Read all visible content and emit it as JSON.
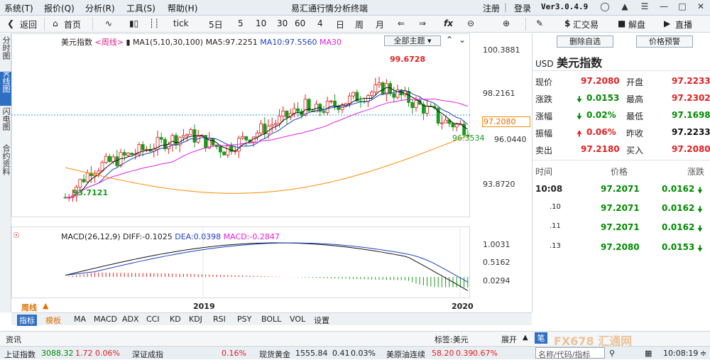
{
  "menubar": {
    "menus": [
      "系统(T)",
      "报价(Q)",
      "分析(R)",
      "工具(S)",
      "帮助(H)"
    ],
    "title": "易汇通行情分析终端",
    "register": "注册",
    "login": "登录",
    "version": "Ver3.0.4.9"
  },
  "toolbar": {
    "back": "返回",
    "home": "首页",
    "tick": "tick",
    "periods": [
      "5日",
      "5",
      "10",
      "30",
      "60",
      "4",
      "日",
      "周",
      "月"
    ],
    "fx": "fx",
    "fx_trade": "汇交易",
    "analysis": "解盘",
    "live": "直播"
  },
  "left_tabs": [
    "分时图",
    "K线图",
    "闪电图",
    "合约资料"
  ],
  "chart": {
    "header_title": "美元指数",
    "header_period": "<周线>",
    "ma_label": "MA1(5,10,30,100)",
    "ma5": "MA5:97.2251",
    "ma10": "MA10:97.5560",
    "ma30": "MA30",
    "theme_button": "全部主题",
    "high_label": "99.6728",
    "low_label": "93.7121",
    "recent_low_label": "96.3534",
    "price_tag": "97.2080",
    "y_ticks": [
      "100.3881",
      "98.2161",
      "96.0440",
      "93.8720"
    ],
    "macd_label": "MACD(26,12,9)",
    "diff": "DIFF:-0.1025",
    "dea": "DEA:0.0398",
    "macd": "MACD:-0.2847",
    "macd_ticks": [
      "1.0031",
      "0.5162",
      "0.0294"
    ],
    "x_labels": [
      "2019",
      "2020"
    ],
    "period_tab": "周线",
    "colors": {
      "up": "#e02020",
      "down": "#1a9a1a",
      "ma5": "#111111",
      "ma10": "#1f3fbf",
      "ma30": "#e020e0",
      "ma100": "#ff8a00"
    }
  },
  "index_tabs": [
    "指标",
    "模板",
    "MA",
    "MACD",
    "ADX",
    "CCI",
    "KD",
    "KDJ",
    "RSI",
    "PSY",
    "BOLL",
    "VOL",
    "设置"
  ],
  "right_panel": {
    "btn_delete": "删除自选",
    "btn_alert": "价格预警",
    "symbol_code": "USD",
    "symbol_name": "美元指数",
    "quotes": [
      {
        "l1": "现价",
        "v1": "97.2080",
        "l2": "开盘",
        "v2": "97.2233"
      },
      {
        "l1": "涨跌",
        "v1": "0.0153",
        "l2": "最高",
        "v2": "97.2302"
      },
      {
        "l1": "涨幅",
        "v1": "0.02%",
        "l2": "最低",
        "v2": "97.1698"
      },
      {
        "l1": "振幅",
        "v1": "0.06%",
        "l2": "昨收",
        "v2": "97.2233"
      },
      {
        "l1": "卖出",
        "v1": "97.2180",
        "l2": "买入",
        "v2": "97.2080"
      }
    ],
    "ticks_header": [
      "时间",
      "价格",
      "涨跌"
    ],
    "ticks": [
      {
        "time": "10:08",
        "price": "97.2071",
        "chg": "0.0162"
      },
      {
        "time": ".10",
        "price": "97.2071",
        "chg": "0.0162"
      },
      {
        "time": ".11",
        "price": "97.2071",
        "chg": "0.0162"
      },
      {
        "time": ".13",
        "price": "97.2080",
        "chg": "0.0153"
      }
    ]
  },
  "infobar": {
    "news": "资讯",
    "tag": "标签:美元",
    "expand": "展开",
    "pen": "笔",
    "search_placeholder": "名称/代码/指标",
    "watermark": "FX678 汇通网"
  },
  "statusbar": {
    "sh_name": "上证指数",
    "sh_val": "3088.32",
    "sh_chg": "1.72",
    "sh_pct": "0.06%",
    "sz_name": "深证成指",
    "sz_pct": "0.16%",
    "gold_name": "现货黄金",
    "gold_val": "1555.84",
    "gold_chg": "0.41",
    "gold_pct": "0.03%",
    "oil_name": "美原油连续",
    "oil_val": "58.20",
    "oil_chg": "0.39",
    "oil_pct": "0.67%",
    "time": "10:08:19"
  }
}
